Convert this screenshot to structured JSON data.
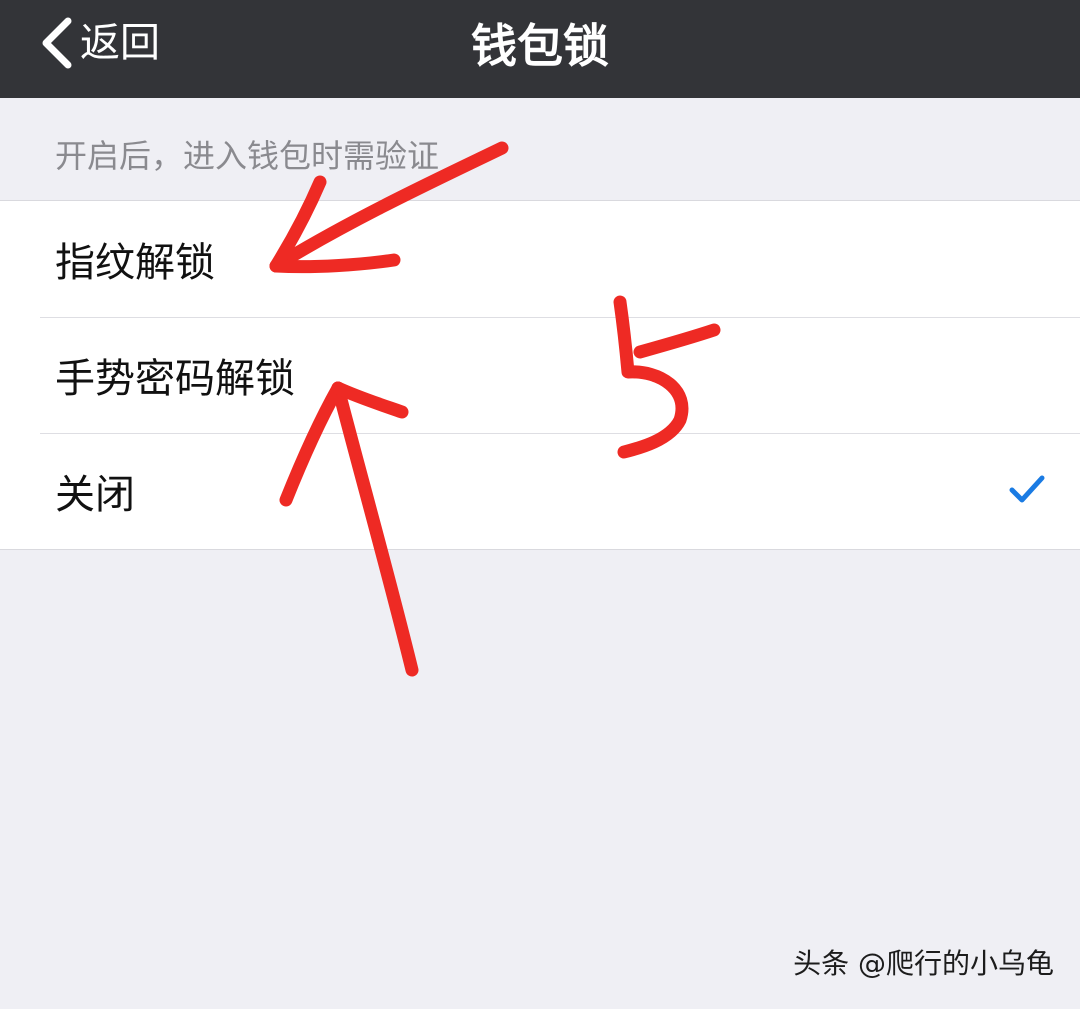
{
  "navbar": {
    "back_label": "返回",
    "title": "钱包锁"
  },
  "section": {
    "header": "开启后，进入钱包时需验证"
  },
  "options": [
    {
      "label": "指纹解锁",
      "selected": false
    },
    {
      "label": "手势密码解锁",
      "selected": false
    },
    {
      "label": "关闭",
      "selected": true
    }
  ],
  "annotation": {
    "step_number": "5",
    "stroke_color": "#ee2a24"
  },
  "watermark": "头条 @爬行的小乌龟",
  "colors": {
    "navbar_bg": "#333438",
    "page_bg": "#efeff4",
    "check_blue": "#1a7be3"
  },
  "icons": {
    "back": "chevron-left-icon",
    "selected": "checkmark-icon"
  }
}
